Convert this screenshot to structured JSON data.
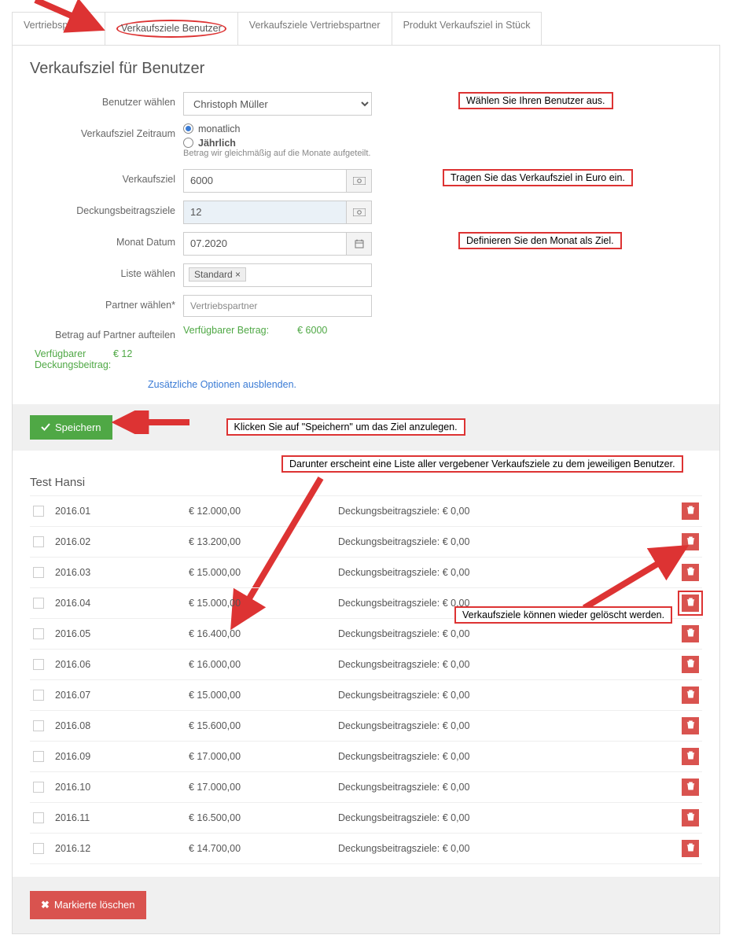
{
  "tabs": {
    "t0": "Vertriebspartner",
    "t1": "Verkaufsziele Benutzer",
    "t2": "Verkaufsziele Vertriebspartner",
    "t3": "Produkt Verkaufsziel in Stück"
  },
  "heading": "Verkaufsziel für Benutzer",
  "labels": {
    "user": "Benutzer wählen",
    "period": "Verkaufsziel Zeitraum",
    "target": "Verkaufsziel",
    "cov": "Deckungsbeitragsziele",
    "month": "Monat Datum",
    "list": "Liste wählen",
    "partner": "Partner wählen*",
    "split": "Betrag auf Partner aufteilen",
    "avail_cov": "Verfügbarer Deckungsbeitrag:"
  },
  "values": {
    "user": "Christoph Müller",
    "radio_monthly": "monatlich",
    "radio_yearly": "Jährlich",
    "yearly_help": "Betrag wir gleichmäßig auf die Monate aufgeteilt.",
    "target": "6000",
    "cov": "12",
    "month": "07.2020",
    "list_tag": "Standard ×",
    "partner": "Vertriebspartner",
    "avail_label": "Verfügbarer Betrag:",
    "avail_amount": "€ 6000",
    "avail_cov_amount": "€ 12",
    "hide_options": "Zusätzliche Optionen ausblenden."
  },
  "annotations": {
    "a_user": "Wählen Sie Ihren Benutzer aus.",
    "a_target": "Tragen Sie das Verkaufsziel in Euro ein.",
    "a_month": "Definieren Sie den Monat als Ziel.",
    "a_save": "Klicken Sie auf \"Speichern\" um das Ziel anzulegen.",
    "a_list": "Darunter erscheint eine Liste aller vergebener Verkaufsziele zu dem jeweiligen Benutzer.",
    "a_delete": "Verkaufsziele können wieder gelöscht werden."
  },
  "buttons": {
    "save": "Speichern",
    "del_marked": "Markierte löschen"
  },
  "list": {
    "title": "Test Hansi",
    "cov_label": "Deckungsbeitragsziele: € 0,00",
    "rows": [
      {
        "date": "2016.01",
        "amt": "€ 12.000,00"
      },
      {
        "date": "2016.02",
        "amt": "€ 13.200,00"
      },
      {
        "date": "2016.03",
        "amt": "€ 15.000,00"
      },
      {
        "date": "2016.04",
        "amt": "€ 15.000,00"
      },
      {
        "date": "2016.05",
        "amt": "€ 16.400,00"
      },
      {
        "date": "2016.06",
        "amt": "€ 16.000,00"
      },
      {
        "date": "2016.07",
        "amt": "€ 15.000,00"
      },
      {
        "date": "2016.08",
        "amt": "€ 15.600,00"
      },
      {
        "date": "2016.09",
        "amt": "€ 17.000,00"
      },
      {
        "date": "2016.10",
        "amt": "€ 17.000,00"
      },
      {
        "date": "2016.11",
        "amt": "€ 16.500,00"
      },
      {
        "date": "2016.12",
        "amt": "€ 14.700,00"
      }
    ]
  }
}
